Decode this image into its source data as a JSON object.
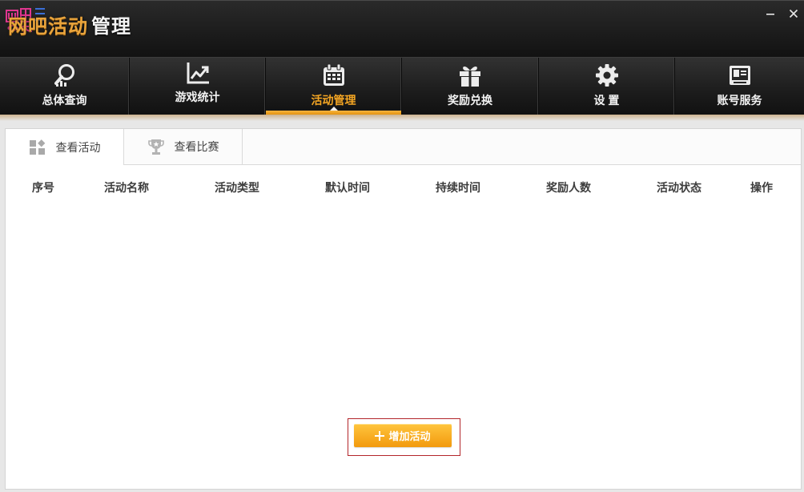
{
  "window": {
    "title_accent": "网吧活动",
    "title_main": "管理",
    "minimize_icon": "minimize-icon",
    "close_icon": "close-icon"
  },
  "colors": {
    "accent": "#f5a623",
    "button_top": "#ffc53d",
    "button_bottom": "#f29a0e",
    "highlight_border": "#b3262b"
  },
  "nav": {
    "items": [
      {
        "label": "总体查询",
        "icon": "search-chart-icon",
        "active": false
      },
      {
        "label": "游戏统计",
        "icon": "line-chart-icon",
        "active": false
      },
      {
        "label": "活动管理",
        "icon": "calendar-icon",
        "active": true
      },
      {
        "label": "奖励兑换",
        "icon": "gift-icon",
        "active": false
      },
      {
        "label": "设 置",
        "icon": "gear-icon",
        "active": false
      },
      {
        "label": "账号服务",
        "icon": "id-card-icon",
        "active": false
      }
    ]
  },
  "tabs": [
    {
      "label": "查看活动",
      "icon": "grid-icon",
      "active": true
    },
    {
      "label": "查看比赛",
      "icon": "trophy-icon",
      "active": false
    }
  ],
  "table": {
    "columns": [
      "序号",
      "活动名称",
      "活动类型",
      "默认时间",
      "持续时间",
      "奖励人数",
      "活动状态",
      "操作"
    ],
    "rows": []
  },
  "actions": {
    "add_label": "增加活动",
    "add_icon": "plus-icon"
  }
}
